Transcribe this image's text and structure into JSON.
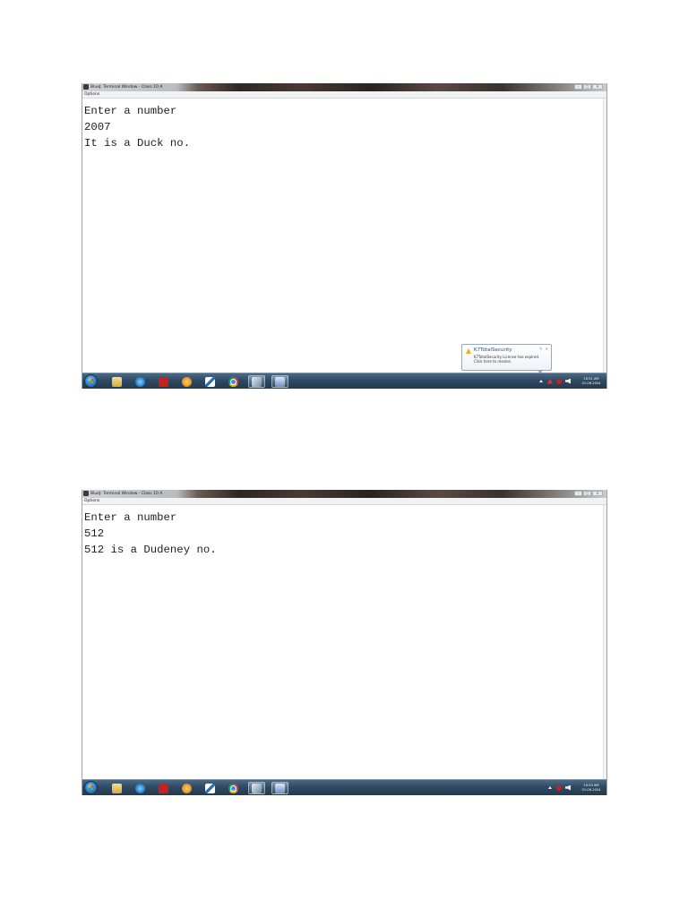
{
  "window": {
    "title": "BlueJ: Terminal Window - Class 10 A",
    "controls": {
      "minimize": "–",
      "maximize": "□",
      "close": "✕"
    },
    "menu": {
      "options": "Options"
    }
  },
  "shots": [
    {
      "lines": [
        "Enter a number",
        "2007",
        "It is a Duck no."
      ],
      "clock": {
        "time": "10:51 AM",
        "date": "01-06-2024"
      },
      "notification": {
        "title": "K7TotalSecurity",
        "line1": "K7TotalSecurity License has expired.",
        "line2": "Click here to resolve.",
        "settings": "✎",
        "close": "✕"
      }
    },
    {
      "lines": [
        "Enter a number",
        "512",
        "512 is a Dudeney no."
      ],
      "clock": {
        "time": "10:53 AM",
        "date": "01-06-2024"
      }
    }
  ],
  "taskbar": {
    "icons": [
      "windows-start-icon",
      "folder-icon",
      "internet-explorer-icon",
      "acrobat-pdf-icon",
      "media-player-icon",
      "document-icon",
      "chrome-icon",
      "bluej-icon",
      "word-icon"
    ]
  },
  "colors": {
    "taskbar": "#2f4a63",
    "terminal_bg": "#ffffff",
    "text": "#1e1e1e",
    "notification_title": "#1c4f9a"
  }
}
